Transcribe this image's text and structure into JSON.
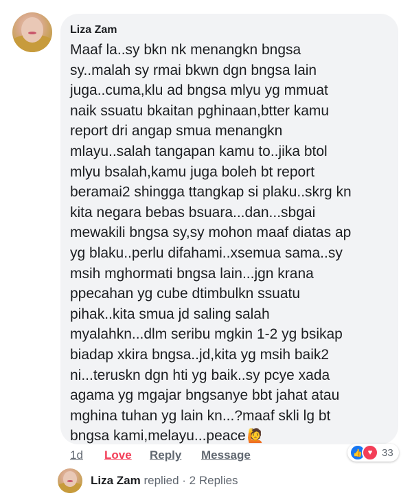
{
  "comment": {
    "author": "Liza Zam",
    "lines": [
      "Maaf la..sy bkn nk menangkn bngsa",
      "sy..malah sy rmai bkwn dgn bngsa lain",
      "juga..cuma,klu ad bngsa mlyu yg mmuat",
      "naik ssuatu bkaitan pghinaan,btter kamu",
      "report dri angap smua menangkn",
      "mlayu..salah tangapan kamu to..jika btol",
      "mlyu bsalah,kamu juga boleh bt report",
      "beramai2 shingga ttangkap si plaku..skrg kn",
      "kita negara bebas bsuara...dan...sbgai",
      "mewakili bngsa sy,sy mohon maaf diatas ap",
      "yg blaku..perlu difahami..xsemua sama..sy",
      "msih mghormati bngsa lain...jgn krana",
      "ppecahan yg cube dtimbulkn ssuatu",
      "pihak..kita smua jd saling salah",
      "myalahkn...dlm seribu mgkin 1-2 yg bsikap",
      "biadap xkira bngsa..jd,kita yg msih baik2",
      "ni...teruskn dgn hti yg baik..sy pcye xada",
      "agama yg mgajar bngsanye bbt jahat atau",
      "mghina tuhan yg lain kn...?maaf skli lg bt",
      "bngsa kami,melayu...peace"
    ],
    "emoji": "🙋",
    "reactions": {
      "count": "33",
      "icons": [
        "like-icon",
        "love-icon"
      ]
    }
  },
  "actions": {
    "time": "1d",
    "love": "Love",
    "reply": "Reply",
    "message": "Message"
  },
  "replies": {
    "author": "Liza Zam",
    "verb": "replied",
    "separator": "·",
    "count_text": "2 Replies"
  },
  "colors": {
    "bubble": "#f2f3f5",
    "love": "#f33e58",
    "like": "#1877f2",
    "meta": "#606770"
  }
}
